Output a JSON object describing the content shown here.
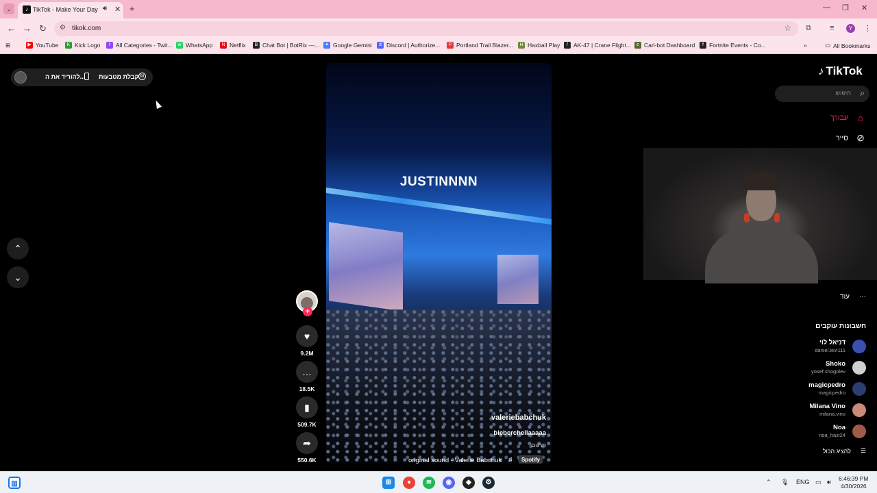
{
  "browser": {
    "tab_title": "TikTok - Make Your Day",
    "url": "tikok.com",
    "bookmarks": [
      {
        "label": "YouTube",
        "color": "#ff0000",
        "glyph": "▶"
      },
      {
        "label": "Kick Logo",
        "color": "#2d9c3a",
        "glyph": "K"
      },
      {
        "label": "All Categories - Twit...",
        "color": "#9146ff",
        "glyph": "t"
      },
      {
        "label": "WhatsApp",
        "color": "#25d366",
        "glyph": "w"
      },
      {
        "label": "Netflix",
        "color": "#e50914",
        "glyph": "N"
      },
      {
        "label": "Chat Bot | BotRix —...",
        "color": "#222222",
        "glyph": "B"
      },
      {
        "label": "Google Gemini",
        "color": "#4a7cf7",
        "glyph": "✦"
      },
      {
        "label": "Discord | Authorize...",
        "color": "#5865f2",
        "glyph": "d"
      },
      {
        "label": "Portland Trail Blazer...",
        "color": "#e03a3e",
        "glyph": "P"
      },
      {
        "label": "Haxball Play",
        "color": "#6d8b3a",
        "glyph": "H"
      },
      {
        "label": "AK-47 | Crane Flight...",
        "color": "#222222",
        "glyph": "/"
      },
      {
        "label": "Carl-bot Dashboard",
        "color": "#556b2f",
        "glyph": "c"
      },
      {
        "label": "Fortnite Events - Co...",
        "color": "#222222",
        "glyph": "f"
      }
    ],
    "all_bookmarks": "All Bookmarks",
    "profile_initial": "Y"
  },
  "tiktok": {
    "logo_text": "TikTok",
    "top_pill": {
      "download_text": "להוריד את ה...",
      "coins_text": "קבלת מטבעות"
    },
    "search_placeholder": "חיפוש",
    "nav": {
      "for_you": "עבורך",
      "explore": "סייר",
      "more": "עוד"
    },
    "accent_color": "#fe2c55",
    "video": {
      "caption": "JUSTINNNN",
      "author": "valeriebabchuk",
      "description": "bieberchellaaaaa",
      "translate": "תרגום",
      "sound": "original sound - Valerie Babchuk",
      "spotify": "Spotify",
      "progress": 0.45
    },
    "actions": {
      "likes": "9.2M",
      "comments": "18.5K",
      "saves": "509.7K",
      "shares": "550.6K"
    },
    "following_title": "חשבונות עוקבים",
    "following": [
      {
        "name": "דניאל לוי",
        "handle": "daniel.levi111",
        "color": "#3a4fb0"
      },
      {
        "name": "Shoko",
        "handle": "yosef.shogolev",
        "color": "#d0d0d0"
      },
      {
        "name": "magicpedro",
        "handle": "magicpedro",
        "color": "#2c3e70"
      },
      {
        "name": "Milana Vino",
        "handle": "milana.vino",
        "color": "#c98a7a"
      },
      {
        "name": "Noa",
        "handle": "noa_hazi24",
        "color": "#a05a4a"
      }
    ],
    "see_all": "להציג הכול"
  },
  "taskbar": {
    "lang": "ENG",
    "time": "6:46:39 PM",
    "date": "4/30/2026"
  }
}
